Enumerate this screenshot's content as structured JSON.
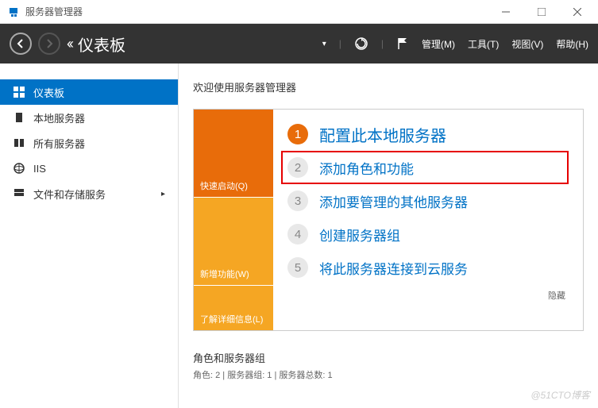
{
  "titlebar": {
    "title": "服务器管理器"
  },
  "header": {
    "page_title": "仪表板",
    "menu": {
      "manage": "管理(M)",
      "tools": "工具(T)",
      "view": "视图(V)",
      "help": "帮助(H)"
    }
  },
  "sidebar": {
    "items": [
      {
        "label": "仪表板"
      },
      {
        "label": "本地服务器"
      },
      {
        "label": "所有服务器"
      },
      {
        "label": "IIS"
      },
      {
        "label": "文件和存储服务"
      }
    ]
  },
  "content": {
    "welcome": "欢迎使用服务器管理器",
    "tiles": {
      "quick": "快速启动(Q)",
      "new": "新增功能(W)",
      "learn": "了解详细信息(L)"
    },
    "steps": [
      {
        "num": "1",
        "text": "配置此本地服务器"
      },
      {
        "num": "2",
        "text": "添加角色和功能"
      },
      {
        "num": "3",
        "text": "添加要管理的其他服务器"
      },
      {
        "num": "4",
        "text": "创建服务器组"
      },
      {
        "num": "5",
        "text": "将此服务器连接到云服务"
      }
    ],
    "hide": "隐藏",
    "roles": {
      "title": "角色和服务器组",
      "sub": "角色: 2 | 服务器组: 1 | 服务器总数: 1"
    }
  },
  "watermark": "@51CTO博客"
}
